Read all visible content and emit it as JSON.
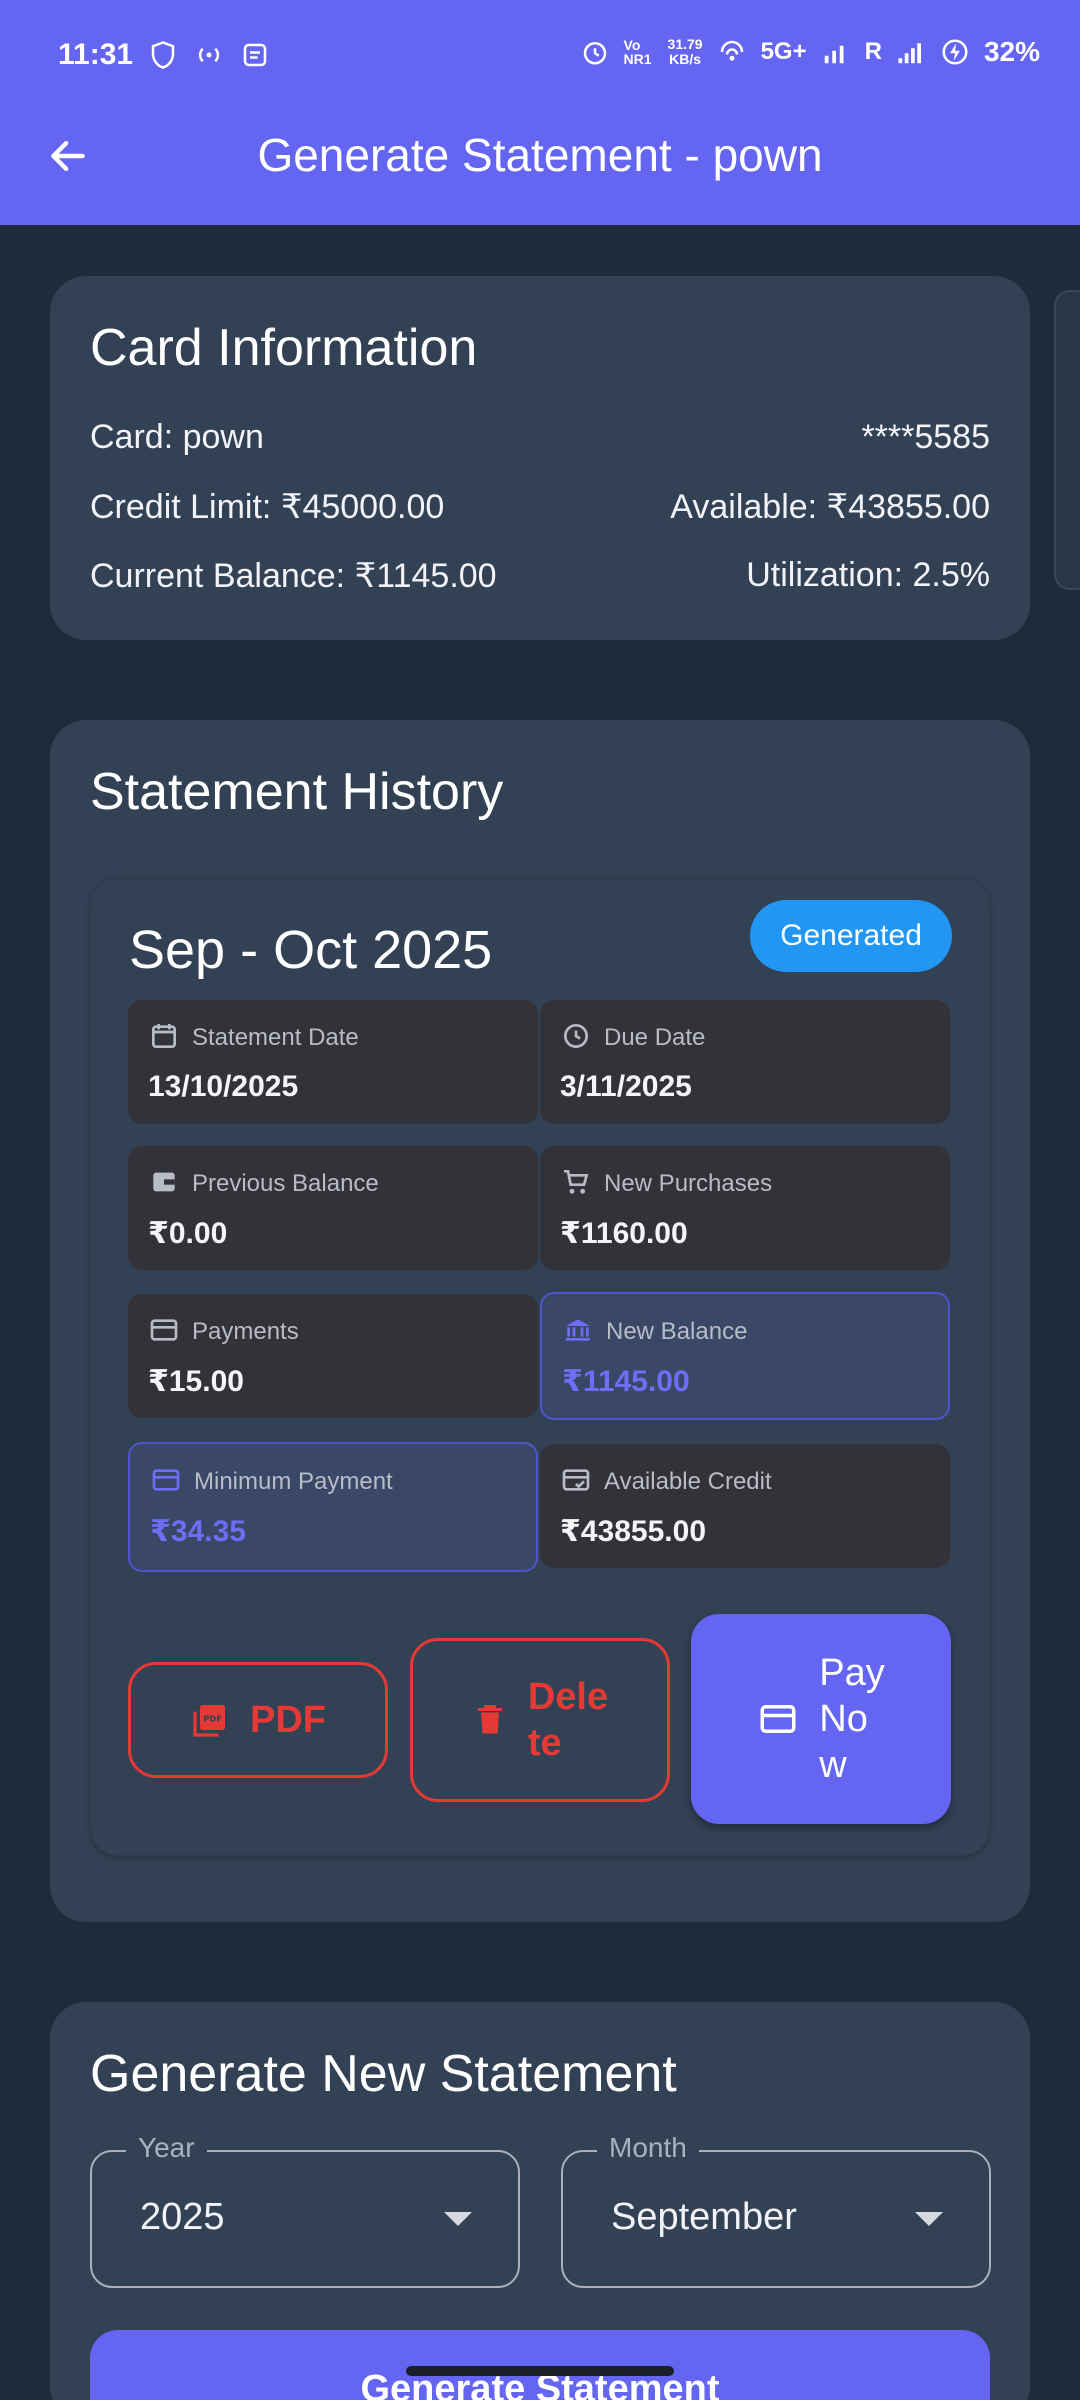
{
  "status_bar": {
    "time": "11:31",
    "net_speed_value": "31.79",
    "net_speed_unit": "KB/s",
    "volte": "Vo NR1",
    "network": "5G+",
    "roaming": "R",
    "battery": "32%"
  },
  "appbar": {
    "title": "Generate Statement - pown"
  },
  "card_info": {
    "heading": "Card Information",
    "card_label": "Card: pown",
    "card_number": "****5585",
    "credit_limit": "Credit Limit: ₹45000.00",
    "available": "Available: ₹43855.00",
    "current_balance": "Current Balance: ₹1145.00",
    "utilization": "Utilization: 2.5%"
  },
  "history": {
    "heading": "Statement History",
    "statement": {
      "period": "Sep - Oct 2025",
      "status": "Generated",
      "tiles": [
        {
          "label": "Statement Date",
          "value": "13/10/2025",
          "icon": "calendar-icon",
          "highlight": false
        },
        {
          "label": "Due Date",
          "value": "3/11/2025",
          "icon": "clock-icon",
          "highlight": false
        },
        {
          "label": "Previous Balance",
          "value": "₹0.00",
          "icon": "wallet-icon",
          "highlight": false
        },
        {
          "label": "New Purchases",
          "value": "₹1160.00",
          "icon": "cart-icon",
          "highlight": false
        },
        {
          "label": "Payments",
          "value": "₹15.00",
          "icon": "card-icon",
          "highlight": false
        },
        {
          "label": "New Balance",
          "value": "₹1145.00",
          "icon": "bank-icon",
          "highlight": true
        },
        {
          "label": "Minimum Payment",
          "value": "₹34.35",
          "icon": "card-icon",
          "highlight": true
        },
        {
          "label": "Available Credit",
          "value": "₹43855.00",
          "icon": "card-check-icon",
          "highlight": false
        }
      ],
      "actions": {
        "pdf": "PDF",
        "delete_line1": "Dele",
        "delete_line2": "te",
        "pay_line1": "Pay",
        "pay_line2": "No",
        "pay_line3": "w"
      }
    }
  },
  "generate": {
    "heading": "Generate New Statement",
    "year_label": "Year",
    "year_value": "2025",
    "month_label": "Month",
    "month_value": "September",
    "button": "Generate Statement"
  },
  "colors": {
    "primary": "#6466f1",
    "background": "#1f2a3a",
    "card": "#334155",
    "danger": "#e53935",
    "badge": "#2196f3"
  }
}
